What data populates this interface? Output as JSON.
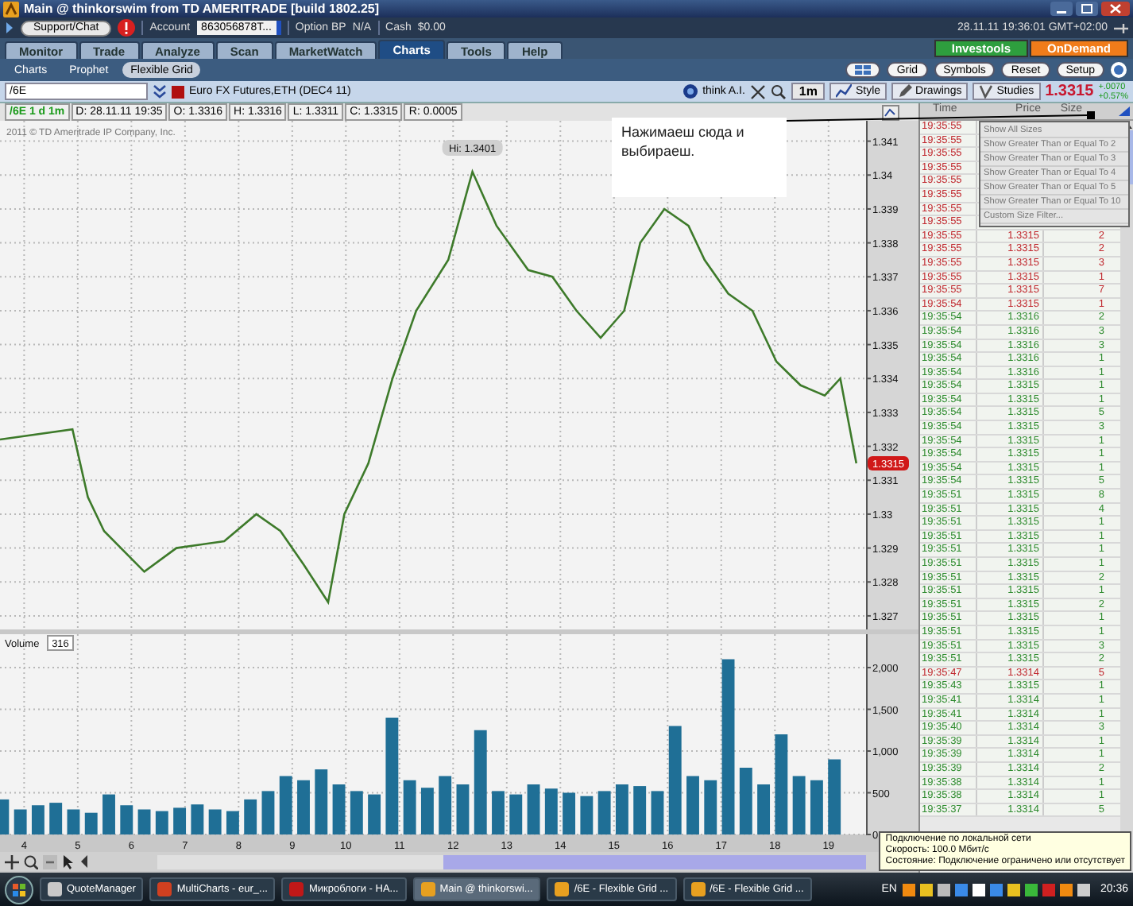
{
  "window": {
    "title": "Main @ thinkorswim from TD AMERITRADE [build 1802.25]"
  },
  "account_bar": {
    "support_button": "Support/Chat",
    "account_label": "Account",
    "account_value": "863056878T...",
    "option_bp_label": "Option BP",
    "option_bp_value": "N/A",
    "cash_label": "Cash",
    "cash_value": "$0.00",
    "datetime": "28.11.11 19:36:01 GMT+02:00"
  },
  "tabs": [
    {
      "label": "Monitor",
      "selected": false
    },
    {
      "label": "Trade",
      "selected": false
    },
    {
      "label": "Analyze",
      "selected": false
    },
    {
      "label": "Scan",
      "selected": false
    },
    {
      "label": "MarketWatch",
      "selected": false
    },
    {
      "label": "Charts",
      "selected": true
    },
    {
      "label": "Tools",
      "selected": false
    },
    {
      "label": "Help",
      "selected": false
    }
  ],
  "promo_buttons": [
    {
      "label": "Investools",
      "color": "#2e9e3e"
    },
    {
      "label": "OnDemand",
      "color": "#f07c1a"
    }
  ],
  "subtabs": [
    {
      "label": "Charts",
      "selected": false
    },
    {
      "label": "Prophet",
      "selected": false
    },
    {
      "label": "Flexible Grid",
      "selected": true
    }
  ],
  "grid_buttons": [
    "Grid",
    "Symbols",
    "Reset",
    "Setup"
  ],
  "chart_toolbar": {
    "symbol": "/6E",
    "description": "Euro FX Futures,ETH (DEC4 11)",
    "think_ai": "think A.I.",
    "aggregation": "1m",
    "style": "Style",
    "drawings": "Drawings",
    "studies": "Studies",
    "last_price": "1.3315",
    "net_change": "+.0070",
    "percent_change": "+0.57%"
  },
  "info_row": [
    "/6E 1 d 1m",
    "D: 28.11.11 19:35",
    "O: 1.3316",
    "H: 1.3316",
    "L: 1.3311",
    "C: 1.3315",
    "R: 0.0005"
  ],
  "price_chart": {
    "copyright": "2011 © TD Ameritrade IP Company, Inc.",
    "high_label": "Hi: 1.3401",
    "price_tag": "1.3315",
    "chart_data": {
      "type": "line",
      "grid": true,
      "xlim": [
        3.55,
        19.7
      ],
      "ylim": [
        1.3266,
        1.3416
      ],
      "yticks": [
        1.341,
        1.34,
        1.339,
        1.338,
        1.337,
        1.336,
        1.335,
        1.334,
        1.333,
        1.332,
        1.331,
        1.33,
        1.329,
        1.328,
        1.327
      ],
      "x": [
        3.55,
        4.9,
        5.19,
        5.49,
        6.24,
        6.84,
        7.73,
        8.33,
        8.78,
        9.22,
        9.67,
        9.97,
        10.42,
        10.87,
        11.31,
        11.91,
        12.36,
        12.81,
        13.4,
        13.85,
        14.3,
        14.75,
        15.19,
        15.49,
        15.94,
        16.39,
        16.69,
        17.13,
        17.58,
        18.03,
        18.48,
        18.93,
        19.22,
        19.52
      ],
      "series": [
        {
          "color": "#3d7a2a",
          "values": [
            1.3322,
            1.3325,
            1.3305,
            1.3295,
            1.3283,
            1.329,
            1.3292,
            1.33,
            1.3295,
            1.3285,
            1.3274,
            1.33,
            1.3315,
            1.334,
            1.336,
            1.3375,
            1.3401,
            1.3385,
            1.3372,
            1.337,
            1.336,
            1.3352,
            1.336,
            1.338,
            1.339,
            1.3385,
            1.3375,
            1.3365,
            1.336,
            1.3345,
            1.3338,
            1.3335,
            1.334,
            1.3315
          ]
        }
      ]
    }
  },
  "volume_chart": {
    "label": "Volume",
    "value": "316",
    "chart_data": {
      "type": "bar",
      "grid": true,
      "xlim": [
        3.55,
        19.7
      ],
      "ylim": [
        0,
        2400
      ],
      "xticks": [
        4,
        5,
        6,
        7,
        8,
        9,
        10,
        11,
        12,
        13,
        14,
        15,
        16,
        17,
        18,
        19
      ],
      "yticks": [
        {
          "value": 2000,
          "label": "2,000"
        },
        {
          "value": 1500,
          "label": "1,500"
        },
        {
          "value": 1000,
          "label": "1,000"
        },
        {
          "value": 500,
          "label": "500"
        },
        {
          "value": 0,
          "label": "0"
        }
      ],
      "x": [
        3.6,
        3.93,
        4.26,
        4.59,
        4.92,
        5.25,
        5.58,
        5.91,
        6.24,
        6.57,
        6.9,
        7.23,
        7.56,
        7.89,
        8.22,
        8.55,
        8.88,
        9.21,
        9.54,
        9.87,
        10.2,
        10.53,
        10.86,
        11.19,
        11.52,
        11.85,
        12.18,
        12.51,
        12.84,
        13.17,
        13.5,
        13.83,
        14.16,
        14.49,
        14.82,
        15.15,
        15.48,
        15.81,
        16.14,
        16.47,
        16.8,
        17.13,
        17.46,
        17.79,
        18.12,
        18.45,
        18.78,
        19.11
      ],
      "series": [
        {
          "color": "#1f6f96",
          "values": [
            420,
            300,
            350,
            380,
            300,
            260,
            480,
            350,
            300,
            280,
            320,
            360,
            300,
            280,
            420,
            520,
            700,
            650,
            780,
            600,
            520,
            480,
            1400,
            650,
            560,
            700,
            600,
            1250,
            520,
            480,
            600,
            550,
            500,
            460,
            520,
            600,
            580,
            520,
            1300,
            700,
            650,
            2100,
            800,
            600,
            1200,
            700,
            650,
            900
          ]
        }
      ]
    }
  },
  "annotation": {
    "text": "Нажимаеш сюда и выбираеш."
  },
  "time_sales": {
    "columns": [
      "Time",
      "Price",
      "Size"
    ],
    "filter_menu": [
      "Show All Sizes",
      "Show Greater Than or Equal To 2",
      "Show Greater Than or Equal To 3",
      "Show Greater Than or Equal To 4",
      "Show Greater Than or Equal To 5",
      "Show Greater Than or Equal To 10",
      "Custom Size Filter..."
    ],
    "rows": [
      {
        "time": "19:35:55",
        "color": "#c0282e"
      },
      {
        "time": "19:35:55",
        "color": "#c0282e"
      },
      {
        "time": "19:35:55",
        "color": "#c0282e"
      },
      {
        "time": "19:35:55",
        "color": "#c0282e"
      },
      {
        "time": "19:35:55",
        "color": "#c0282e"
      },
      {
        "time": "19:35:55",
        "color": "#c0282e"
      },
      {
        "time": "19:35:55",
        "color": "#c0282e"
      },
      {
        "time": "19:35:55",
        "color": "#c0282e"
      },
      {
        "time": "19:35:55",
        "price": "1.3315",
        "size": "2",
        "color": "#c0282e"
      },
      {
        "time": "19:35:55",
        "price": "1.3315",
        "size": "2",
        "color": "#c0282e"
      },
      {
        "time": "19:35:55",
        "price": "1.3315",
        "size": "3",
        "color": "#c0282e"
      },
      {
        "time": "19:35:55",
        "price": "1.3315",
        "size": "1",
        "color": "#c0282e"
      },
      {
        "time": "19:35:55",
        "price": "1.3315",
        "size": "7",
        "color": "#c0282e"
      },
      {
        "time": "19:35:54",
        "price": "1.3315",
        "size": "1",
        "color": "#c0282e"
      },
      {
        "time": "19:35:54",
        "price": "1.3316",
        "size": "2",
        "color": "#2e8b2e"
      },
      {
        "time": "19:35:54",
        "price": "1.3316",
        "size": "3",
        "color": "#2e8b2e"
      },
      {
        "time": "19:35:54",
        "price": "1.3316",
        "size": "3",
        "color": "#2e8b2e"
      },
      {
        "time": "19:35:54",
        "price": "1.3316",
        "size": "1",
        "color": "#2e8b2e"
      },
      {
        "time": "19:35:54",
        "price": "1.3316",
        "size": "1",
        "color": "#2e8b2e"
      },
      {
        "time": "19:35:54",
        "price": "1.3315",
        "size": "1",
        "color": "#2e8b2e"
      },
      {
        "time": "19:35:54",
        "price": "1.3315",
        "size": "1",
        "color": "#2e8b2e"
      },
      {
        "time": "19:35:54",
        "price": "1.3315",
        "size": "5",
        "color": "#2e8b2e"
      },
      {
        "time": "19:35:54",
        "price": "1.3315",
        "size": "3",
        "color": "#2e8b2e"
      },
      {
        "time": "19:35:54",
        "price": "1.3315",
        "size": "1",
        "color": "#2e8b2e"
      },
      {
        "time": "19:35:54",
        "price": "1.3315",
        "size": "1",
        "color": "#2e8b2e"
      },
      {
        "time": "19:35:54",
        "price": "1.3315",
        "size": "1",
        "color": "#2e8b2e"
      },
      {
        "time": "19:35:54",
        "price": "1.3315",
        "size": "5",
        "color": "#2e8b2e"
      },
      {
        "time": "19:35:51",
        "price": "1.3315",
        "size": "8",
        "color": "#2e8b2e"
      },
      {
        "time": "19:35:51",
        "price": "1.3315",
        "size": "4",
        "color": "#2e8b2e"
      },
      {
        "time": "19:35:51",
        "price": "1.3315",
        "size": "1",
        "color": "#2e8b2e"
      },
      {
        "time": "19:35:51",
        "price": "1.3315",
        "size": "1",
        "color": "#2e8b2e"
      },
      {
        "time": "19:35:51",
        "price": "1.3315",
        "size": "1",
        "color": "#2e8b2e"
      },
      {
        "time": "19:35:51",
        "price": "1.3315",
        "size": "1",
        "color": "#2e8b2e"
      },
      {
        "time": "19:35:51",
        "price": "1.3315",
        "size": "2",
        "color": "#2e8b2e"
      },
      {
        "time": "19:35:51",
        "price": "1.3315",
        "size": "1",
        "color": "#2e8b2e"
      },
      {
        "time": "19:35:51",
        "price": "1.3315",
        "size": "2",
        "color": "#2e8b2e"
      },
      {
        "time": "19:35:51",
        "price": "1.3315",
        "size": "1",
        "color": "#2e8b2e"
      },
      {
        "time": "19:35:51",
        "price": "1.3315",
        "size": "1",
        "color": "#2e8b2e"
      },
      {
        "time": "19:35:51",
        "price": "1.3315",
        "size": "3",
        "color": "#2e8b2e"
      },
      {
        "time": "19:35:51",
        "price": "1.3315",
        "size": "2",
        "color": "#2e8b2e"
      },
      {
        "time": "19:35:47",
        "price": "1.3314",
        "size": "5",
        "color": "#c0282e"
      },
      {
        "time": "19:35:43",
        "price": "1.3315",
        "size": "1",
        "color": "#2e8b2e"
      },
      {
        "time": "19:35:41",
        "price": "1.3314",
        "size": "1",
        "color": "#2e8b2e"
      },
      {
        "time": "19:35:41",
        "price": "1.3314",
        "size": "1",
        "color": "#2e8b2e"
      },
      {
        "time": "19:35:40",
        "price": "1.3314",
        "size": "3",
        "color": "#2e8b2e"
      },
      {
        "time": "19:35:39",
        "price": "1.3314",
        "size": "1",
        "color": "#2e8b2e"
      },
      {
        "time": "19:35:39",
        "price": "1.3314",
        "size": "1",
        "color": "#2e8b2e"
      },
      {
        "time": "19:35:39",
        "price": "1.3314",
        "size": "2",
        "color": "#2e8b2e"
      },
      {
        "time": "19:35:38",
        "price": "1.3314",
        "size": "1",
        "color": "#2e8b2e"
      },
      {
        "time": "19:35:38",
        "price": "1.3314",
        "size": "1",
        "color": "#2e8b2e"
      },
      {
        "time": "19:35:37",
        "price": "1.3314",
        "size": "5",
        "color": "#2e8b2e"
      }
    ]
  },
  "tooltip": {
    "lines": [
      "Подключение по локальной сети",
      "Скорость: 100.0 Мбит/с",
      "Состояние: Подключение ограничено или отсутствует"
    ]
  },
  "taskbar": {
    "items": [
      {
        "label": "QuoteManager",
        "selected": false
      },
      {
        "label": "MultiCharts - eur_...",
        "selected": false
      },
      {
        "label": "Микроблоги - НА...",
        "selected": false
      },
      {
        "label": "Main @ thinkorswi...",
        "selected": true
      },
      {
        "label": "/6E - Flexible Grid ...",
        "selected": false
      },
      {
        "label": "/6E - Flexible Grid ...",
        "selected": false
      }
    ],
    "language": "EN",
    "clock": "20:36"
  }
}
